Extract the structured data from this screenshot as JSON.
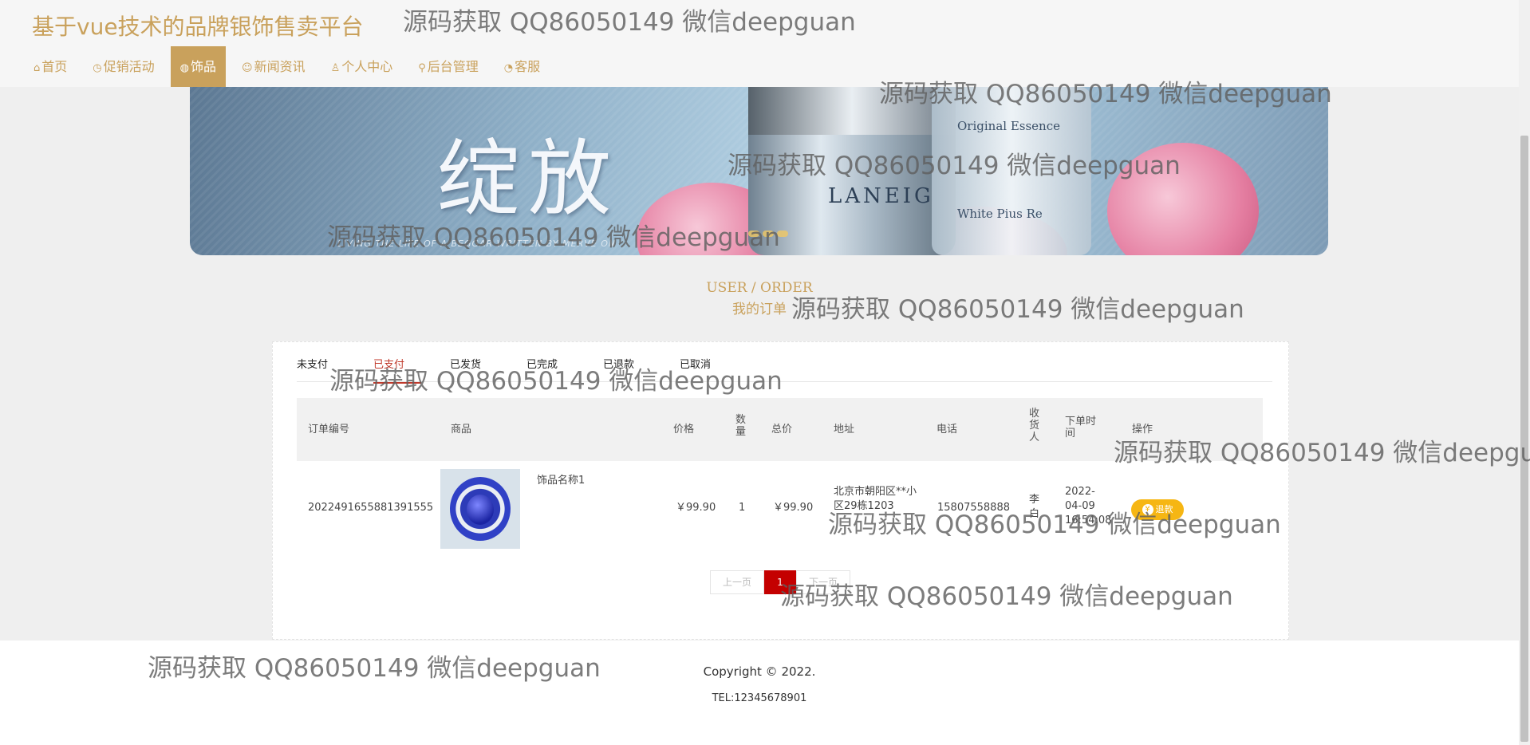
{
  "site": {
    "title": "基于vue技术的品牌银饰售卖平台"
  },
  "nav": [
    {
      "icon": "home-icon",
      "glyph": "⌂",
      "label": "首页",
      "active": false
    },
    {
      "icon": "clock-icon",
      "glyph": "◷",
      "label": "促销活动",
      "active": false
    },
    {
      "icon": "globe-icon",
      "glyph": "◍",
      "label": "饰品",
      "active": true
    },
    {
      "icon": "news-icon",
      "glyph": "☺",
      "label": "新闻资讯",
      "active": false
    },
    {
      "icon": "user-icon",
      "glyph": "♙",
      "label": "个人中心",
      "active": false
    },
    {
      "icon": "link-icon",
      "glyph": "⚲",
      "label": "后台管理",
      "active": false
    },
    {
      "icon": "service-icon",
      "glyph": "◔",
      "label": "客服",
      "active": false
    }
  ],
  "banner": {
    "title": "绽放",
    "brand": "LANEIG",
    "bottle_text": "Original Essence",
    "bottle_text2": "White Pius Re",
    "tagline": "LIVING THE LIFE OF A BEGGAR WRITTEN BY MERVE ON"
  },
  "section": {
    "en": "USER / ORDER",
    "cn": "我的订单"
  },
  "tabs": [
    "未支付",
    "已支付",
    "已发货",
    "已完成",
    "已退款",
    "已取消"
  ],
  "active_tab": "已支付",
  "table": {
    "headers": {
      "order_no": "订单编号",
      "product": "商品",
      "price": "价格",
      "qty": "数量",
      "total": "总价",
      "address": "地址",
      "phone": "电话",
      "receiver": "收货人",
      "time": "下单时间",
      "action": "操作"
    },
    "rows": [
      {
        "order_no": "2022491655881391555",
        "product_name": "饰品名称1",
        "price": "￥99.90",
        "qty": "1",
        "total": "￥99.90",
        "address": "北京市朝阳区**小区29栋1203",
        "phone": "15807558888",
        "receiver": "李白",
        "time": "2022-04-09 16:54:08",
        "action_label": "退款"
      }
    ]
  },
  "pagination": {
    "prev": "上一页",
    "current": "1",
    "next": "下一页"
  },
  "footer": {
    "copyright": "Copyright © 2022.",
    "tel": "TEL:12345678901"
  },
  "watermark": "源码获取 QQ86050149 微信deepguan",
  "colors": {
    "accent": "#c9a15c",
    "active_tab": "#c0392b",
    "page_current": "#c40000",
    "refund": "#f6b613"
  }
}
